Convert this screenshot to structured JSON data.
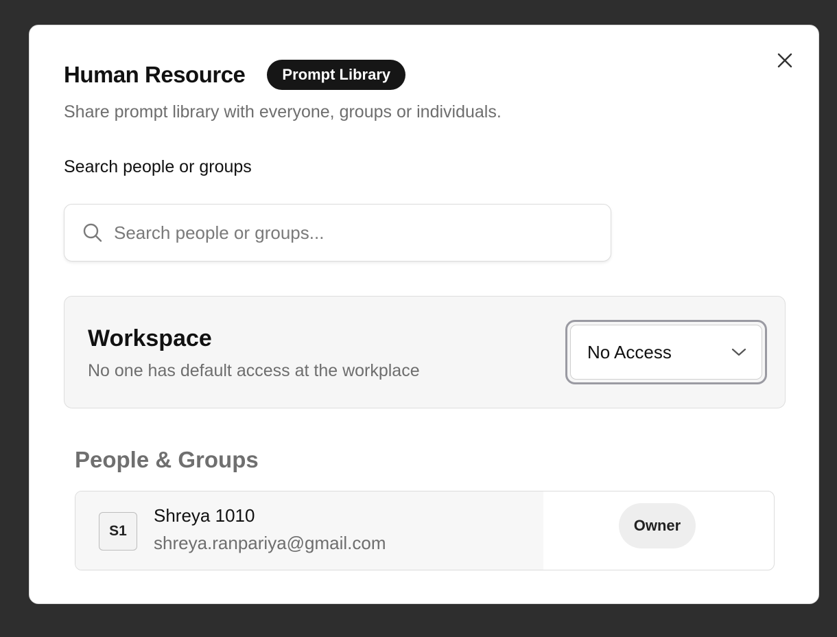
{
  "modal": {
    "title": "Human Resource",
    "badge": "Prompt Library",
    "subtitle": "Share prompt library with everyone, groups or individuals."
  },
  "search": {
    "label": "Search people or groups",
    "placeholder": "Search people or groups...",
    "value": ""
  },
  "workspace": {
    "title": "Workspace",
    "description": "No one has default access at the workplace",
    "access_value": "No Access"
  },
  "people_groups": {
    "title": "People & Groups",
    "members": [
      {
        "initials": "S1",
        "name": "Shreya 1010",
        "email": "shreya.ranpariya@gmail.com",
        "role": "Owner"
      }
    ]
  },
  "icons": {
    "close": "close-icon",
    "search": "search-icon",
    "dropdown": "chevron-down-icon"
  },
  "colors": {
    "backdrop": "#2e2e2e",
    "badge_bg": "#161616",
    "muted_text": "#6e6e6e"
  }
}
